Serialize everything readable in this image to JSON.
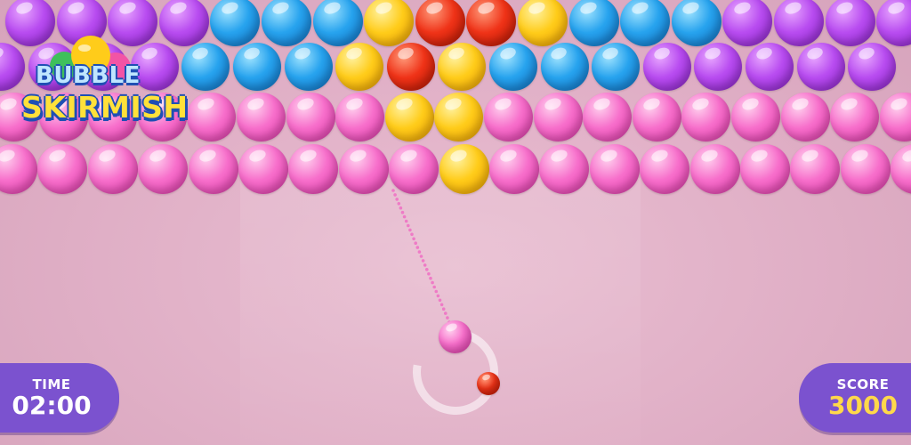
{
  "game": {
    "logo": {
      "line1": "BUBBLE",
      "line2": "SKIRMISH"
    },
    "hud": {
      "time_label": "TIME",
      "time_value": "02:00",
      "score_label": "SCORE",
      "score_value": "3000"
    },
    "colors": {
      "purple": "#b84cf0",
      "blue": "#27a3ee",
      "yellow": "#ffcc1a",
      "red": "#ef3318",
      "pink": "#f76fcb",
      "panel": "#7b52cf",
      "score_text": "#ffd84a"
    },
    "grid": {
      "rows": [
        [
          "purple",
          "purple",
          "purple",
          "purple",
          "blue",
          "blue",
          "blue",
          "yellow",
          "red",
          "red",
          "yellow",
          "blue",
          "blue",
          "blue",
          "purple",
          "purple",
          "purple",
          "purple"
        ],
        [
          "purple",
          "purple",
          "purple",
          "purple",
          "blue",
          "blue",
          "blue",
          "yellow",
          "red",
          "yellow",
          "blue",
          "blue",
          "blue",
          "purple",
          "purple",
          "purple",
          "purple",
          "purple"
        ],
        [
          "pink",
          "pink",
          "pink",
          "pink",
          "pink",
          "pink",
          "pink",
          "pink",
          "yellow",
          "yellow",
          "pink",
          "pink",
          "pink",
          "pink",
          "pink",
          "pink",
          "pink",
          "pink",
          "pink"
        ],
        [
          "pink",
          "pink",
          "pink",
          "pink",
          "pink",
          "pink",
          "pink",
          "pink",
          "pink",
          "yellow",
          "pink",
          "pink",
          "pink",
          "pink",
          "pink",
          "pink",
          "pink",
          "pink",
          "pink"
        ]
      ]
    },
    "shooter": {
      "current": "pink",
      "next": "red"
    }
  }
}
